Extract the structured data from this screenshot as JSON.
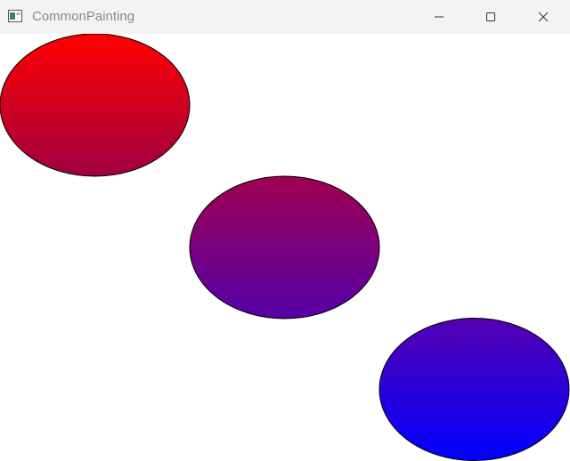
{
  "window": {
    "title": "CommonPainting"
  },
  "titlebar": {
    "app_icon": "window-app-icon",
    "controls": [
      "minimize-icon",
      "maximize-icon",
      "close-icon"
    ]
  },
  "canvas": {
    "background": "#ffffff",
    "ellipses": [
      {
        "name": "ellipse-top-left",
        "gradient_top": "#ff0000",
        "gradient_bottom": "#a00040",
        "stroke": "#000000"
      },
      {
        "name": "ellipse-center",
        "gradient_top": "#a00050",
        "gradient_bottom": "#5500a8",
        "stroke": "#000000"
      },
      {
        "name": "ellipse-bottom-right",
        "gradient_top": "#5500b0",
        "gradient_bottom": "#0000ff",
        "stroke": "#000000"
      }
    ]
  }
}
